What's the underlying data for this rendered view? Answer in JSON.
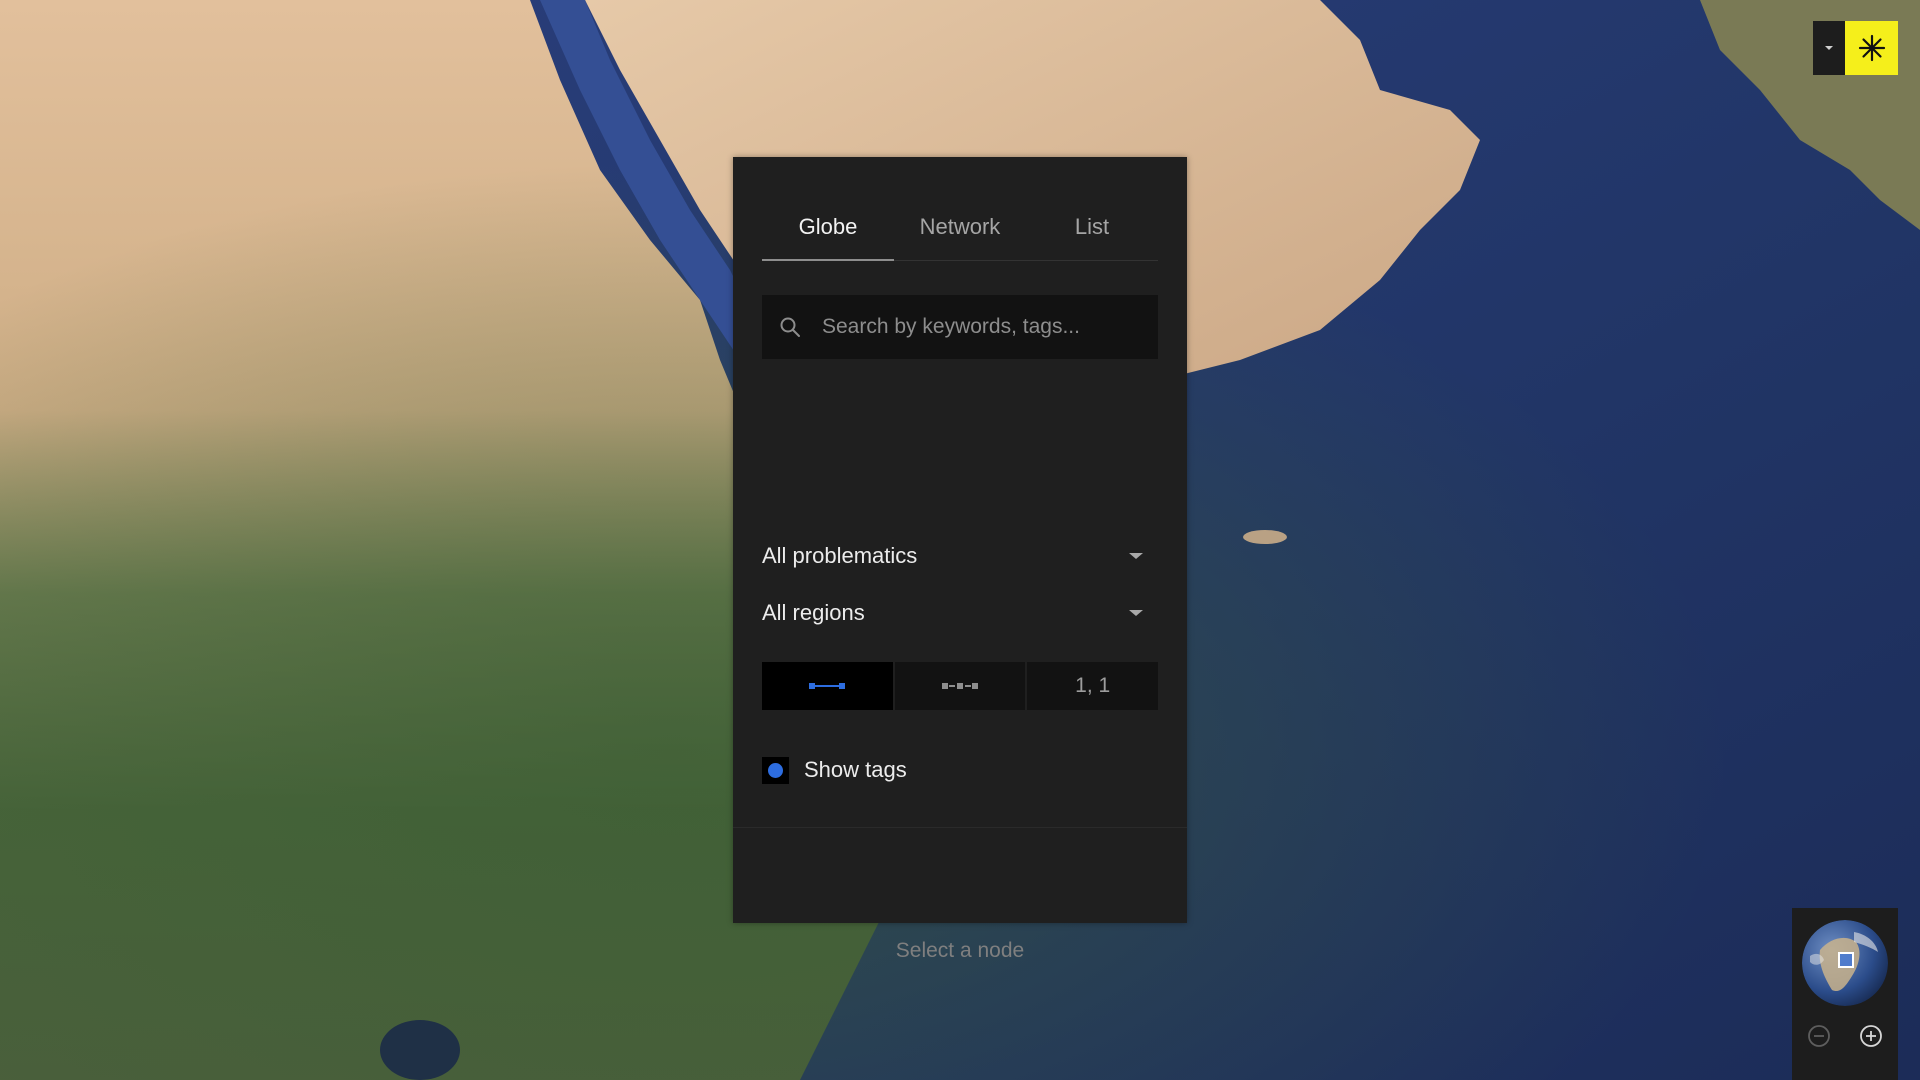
{
  "app": {
    "tabs": [
      {
        "label": "Globe",
        "active": true
      },
      {
        "label": "Network",
        "active": false
      },
      {
        "label": "List",
        "active": false
      }
    ],
    "search": {
      "placeholder": "Search by keywords, tags..."
    },
    "filters": {
      "problematics": "All problematics",
      "regions": "All regions"
    },
    "modes": [
      {
        "icon": "connected-line-icon",
        "active": true
      },
      {
        "icon": "dashed-line-icon",
        "active": false
      },
      {
        "label": "1, 1",
        "active": false
      }
    ],
    "show_tags": {
      "label": "Show tags",
      "checked": true
    },
    "empty_state": "Select a node"
  },
  "controls": {
    "top_right": {
      "dropdown_icon": "caret-down-icon",
      "brand_icon": "asterisk-icon"
    },
    "minimap": {
      "icon": "globe-icon",
      "zoom_out_icon": "minus-circle-icon",
      "zoom_in_icon": "plus-circle-icon"
    }
  },
  "colors": {
    "accent_yellow": "#f5ef1b",
    "accent_blue": "#2d6de0",
    "panel_bg": "#1f1f1f",
    "ocean": "#22336a",
    "desert": "#d8b48f",
    "vegetation": "#4c6a3e"
  }
}
